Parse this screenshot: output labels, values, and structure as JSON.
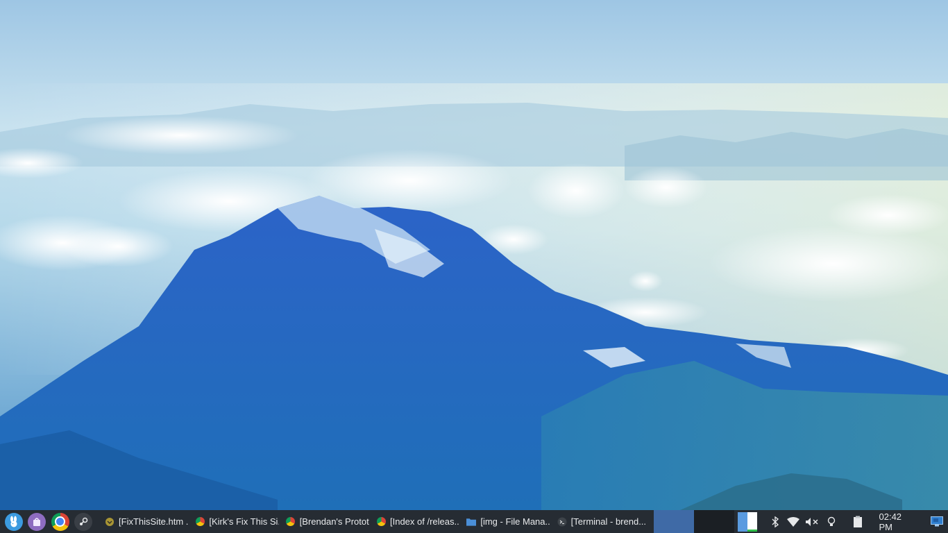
{
  "desktop": {
    "wallpaper_description_icon": "mountain-landscape-wallpaper"
  },
  "taskbar": {
    "launchers": [
      {
        "name": "app-menu-launcher",
        "icon": "bunny-menu-icon",
        "color": "#3c9be0"
      },
      {
        "name": "software-center-launcher",
        "icon": "bag-icon",
        "color": "#8e6cc0"
      },
      {
        "name": "chrome-launcher",
        "icon": "chrome-icon",
        "color": "#dd4b39"
      },
      {
        "name": "steam-launcher",
        "icon": "steam-icon",
        "color": "#3a3f46"
      }
    ],
    "tasks": [
      {
        "label": "[FixThisSite.htm ...",
        "icon": "web-page-icon"
      },
      {
        "label": "[Kirk's Fix This Si...",
        "icon": "chrome-icon"
      },
      {
        "label": "[Brendan's Protot...",
        "icon": "chrome-icon"
      },
      {
        "label": "[Index of /releas...",
        "icon": "chrome-icon"
      },
      {
        "label": "[img - File Mana...",
        "icon": "folder-icon"
      },
      {
        "label": "[Terminal - brend...",
        "icon": "terminal-icon"
      }
    ],
    "workspace_colors": {
      "active": "#3f6aa6",
      "inactive": "#1b1f24"
    },
    "tray": {
      "bluetooth": "bluetooth-icon",
      "wifi": "wifi-icon",
      "volume": "volume-muted-icon",
      "brightness": "lightbulb-icon",
      "clipboard": "clipboard-icon"
    },
    "clock": "02:42 PM",
    "show_desktop": "show-desktop-icon"
  }
}
